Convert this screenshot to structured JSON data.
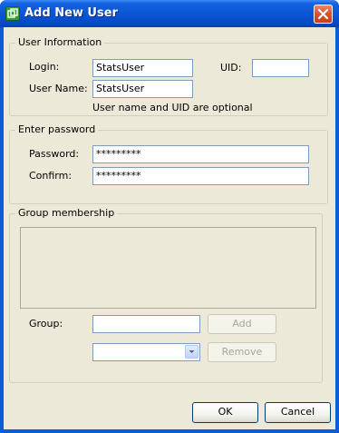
{
  "window": {
    "title": "Add New User",
    "icon": "app-icon",
    "close_icon": "close-icon"
  },
  "user_info": {
    "caption": "User Information",
    "login_label": "Login:",
    "login_value": "StatsUser",
    "uid_label": "UID:",
    "uid_value": "",
    "username_label": "User Name:",
    "username_value": "StatsUser",
    "hint": "User name and UID are optional"
  },
  "password": {
    "caption": "Enter password",
    "password_label": "Password:",
    "password_value": "*********",
    "confirm_label": "Confirm:",
    "confirm_value": "*********"
  },
  "group": {
    "caption": "Group membership",
    "group_label": "Group:",
    "group_value": "",
    "add_label": "Add",
    "remove_label": "Remove",
    "select_value": ""
  },
  "footer": {
    "ok_label": "OK",
    "cancel_label": "Cancel"
  },
  "colors": {
    "titlebar": "#0a55d4",
    "dialog_bg": "#ece9d8",
    "close_button": "#d8542e"
  }
}
